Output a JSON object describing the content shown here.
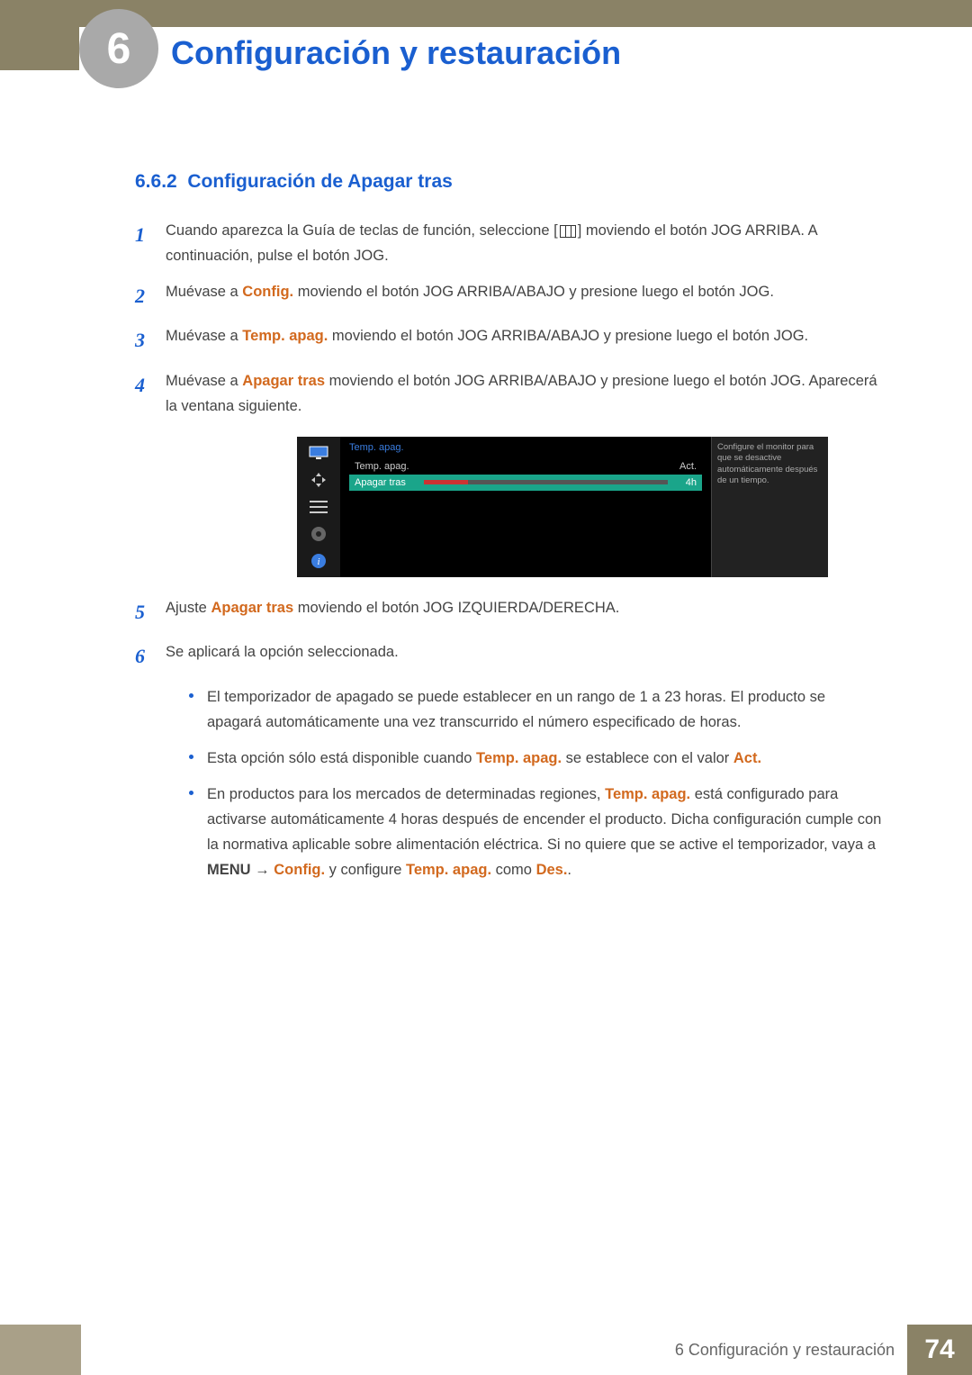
{
  "header": {
    "chapter_number": "6",
    "chapter_title": "Configuración y restauración"
  },
  "section": {
    "number": "6.6.2",
    "title": "Configuración de Apagar tras"
  },
  "steps": {
    "s1_a": "Cuando aparezca la Guía de teclas de función, seleccione [",
    "s1_b": "] moviendo el botón JOG ARRIBA. A continuación, pulse el botón JOG.",
    "s2_a": "Muévase a ",
    "s2_config": "Config.",
    "s2_b": " moviendo el botón JOG ARRIBA/ABAJO y presione luego el botón JOG.",
    "s3_a": "Muévase a ",
    "s3_temp": "Temp. apag.",
    "s3_b": " moviendo el botón JOG ARRIBA/ABAJO y presione luego el botón JOG.",
    "s4_a": "Muévase a ",
    "s4_apagar": "Apagar tras",
    "s4_b": " moviendo el botón JOG ARRIBA/ABAJO y presione luego el botón JOG. Aparecerá la ventana siguiente.",
    "s5_a": "Ajuste ",
    "s5_apagar": "Apagar tras",
    "s5_b": " moviendo el botón JOG IZQUIERDA/DERECHA.",
    "s6": "Se aplicará la opción seleccionada."
  },
  "osd": {
    "title": "Temp. apag.",
    "row1_label": "Temp. apag.",
    "row1_value": "Act.",
    "row2_label": "Apagar tras",
    "row2_value": "4h",
    "help": "Configure el monitor para que se desactive automáticamente después de un tiempo."
  },
  "bullets": {
    "b1": "El temporizador de apagado se puede establecer en un rango de 1 a 23 horas. El producto se apagará automáticamente una vez transcurrido el número especificado de horas.",
    "b2_a": "Esta opción sólo está disponible cuando ",
    "b2_temp": "Temp. apag.",
    "b2_b": " se establece con el valor ",
    "b2_act": "Act.",
    "b3_a": "En productos para los mercados de determinadas regiones, ",
    "b3_temp": "Temp. apag.",
    "b3_b": " está configurado para activarse automáticamente 4 horas después de encender el producto. Dicha configuración cumple con la normativa aplicable sobre alimentación eléctrica. Si no quiere que se active el temporizador, vaya a ",
    "b3_menu": "MENU",
    "b3_arrow": " → ",
    "b3_config": "Config.",
    "b3_c": " y configure ",
    "b3_temp2": "Temp. apag.",
    "b3_d": " como ",
    "b3_des": "Des.",
    "b3_dot": "."
  },
  "footer": {
    "section_label": "6 Configuración y restauración",
    "page": "74"
  }
}
